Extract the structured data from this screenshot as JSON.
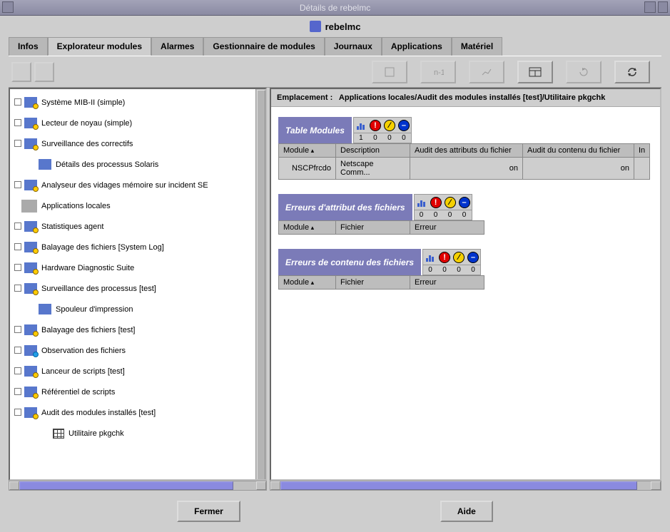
{
  "window": {
    "title": "Détails de rebelmc",
    "subtitle": "rebelmc"
  },
  "tabs": [
    {
      "label": "Infos"
    },
    {
      "label": "Explorateur modules",
      "active": true
    },
    {
      "label": "Alarmes"
    },
    {
      "label": "Gestionnaire de modules"
    },
    {
      "label": "Journaux"
    },
    {
      "label": "Applications"
    },
    {
      "label": "Matériel"
    }
  ],
  "tree": [
    {
      "level": 0,
      "toggle": true,
      "icon": "module",
      "label": "Système MIB-II (simple)"
    },
    {
      "level": 0,
      "toggle": true,
      "icon": "module",
      "label": "Lecteur de noyau (simple)"
    },
    {
      "level": 0,
      "toggle": true,
      "icon": "module",
      "label": "Surveillance des correctifs"
    },
    {
      "level": 1,
      "toggle": false,
      "icon": "module-nobadge",
      "label": "Détails des processus Solaris"
    },
    {
      "level": 0,
      "toggle": true,
      "icon": "module",
      "label": "Analyseur des vidages mémoire sur incident SE"
    },
    {
      "level": -1,
      "toggle": false,
      "icon": "apps",
      "label": "Applications locales"
    },
    {
      "level": 0,
      "toggle": true,
      "icon": "module",
      "label": "Statistiques agent"
    },
    {
      "level": 0,
      "toggle": true,
      "icon": "module",
      "label": "Balayage des fichiers [System Log]"
    },
    {
      "level": 0,
      "toggle": true,
      "icon": "module",
      "label": "Hardware Diagnostic Suite"
    },
    {
      "level": 0,
      "toggle": true,
      "icon": "module",
      "label": "Surveillance des processus [test]"
    },
    {
      "level": 1,
      "toggle": false,
      "icon": "module-nobadge",
      "label": "Spouleur d'impression"
    },
    {
      "level": 0,
      "toggle": true,
      "icon": "module",
      "label": "Balayage des fichiers [test]"
    },
    {
      "level": 0,
      "toggle": true,
      "icon": "module-blue",
      "label": "Observation des fichiers"
    },
    {
      "level": 0,
      "toggle": true,
      "icon": "module",
      "label": "Lanceur de scripts [test]"
    },
    {
      "level": 0,
      "toggle": true,
      "icon": "module",
      "label": "Référentiel de scripts"
    },
    {
      "level": 0,
      "toggle": true,
      "icon": "module",
      "label": "Audit des modules installés [test]"
    },
    {
      "level": 2,
      "toggle": false,
      "icon": "table",
      "label": "Utilitaire pkgchk"
    }
  ],
  "location": {
    "label": "Emplacement :",
    "value": "Applications locales/Audit des modules installés [test]/Utilitaire pkgchk"
  },
  "sections": {
    "table_modules": {
      "title": "Table Modules",
      "status": [
        "1",
        "0",
        "0",
        "0"
      ],
      "columns": [
        "Module",
        "Description",
        "Audit des attributs du fichier",
        "Audit du contenu du fichier",
        "In"
      ],
      "rows": [
        {
          "c0": "NSCPfrcdo",
          "c1": "Netscape Comm...",
          "c2": "on",
          "c3": "on",
          "c4": ""
        }
      ]
    },
    "attr_errors": {
      "title": "Erreurs d'attribut des fichiers",
      "status": [
        "0",
        "0",
        "0",
        "0"
      ],
      "columns": [
        "Module",
        "Fichier",
        "Erreur"
      ]
    },
    "content_errors": {
      "title": "Erreurs de contenu des fichiers",
      "status": [
        "0",
        "0",
        "0",
        "0"
      ],
      "columns": [
        "Module",
        "Fichier",
        "Erreur"
      ]
    }
  },
  "buttons": {
    "close": "Fermer",
    "help": "Aide"
  }
}
